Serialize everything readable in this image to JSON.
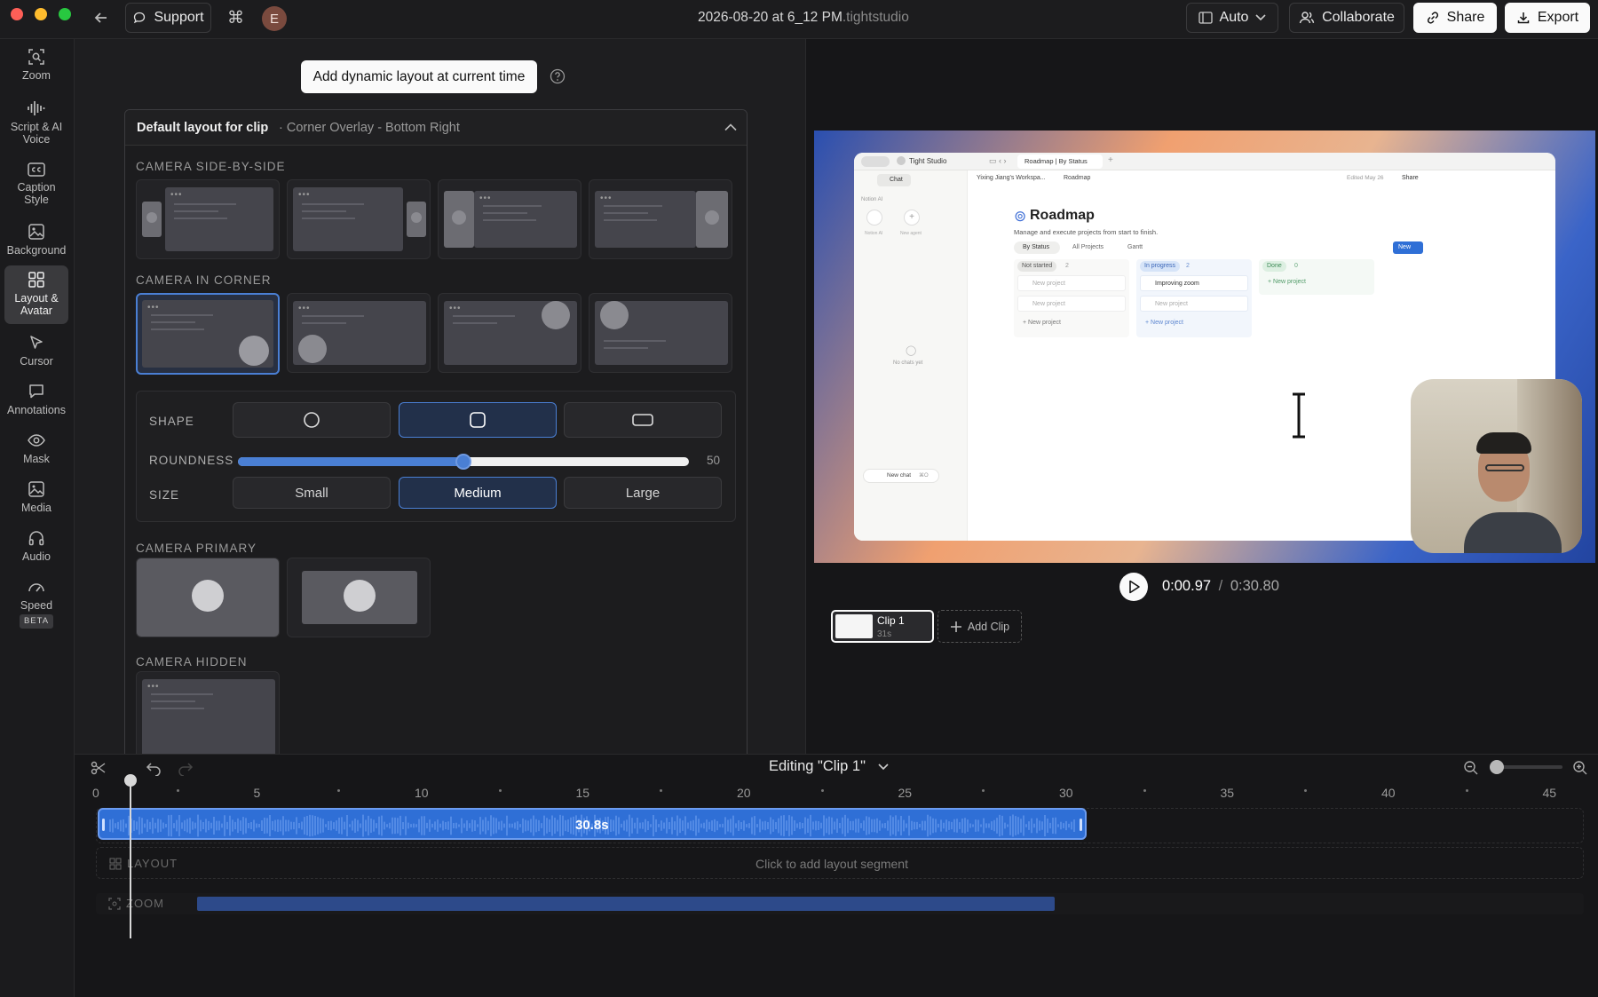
{
  "titlebar": {
    "support_label": "Support",
    "avatar_initial": "E",
    "file_title": "2026-08-20 at 6_12 PM",
    "file_ext": ".tightstudio",
    "auto_label": "Auto",
    "collaborate_label": "Collaborate",
    "share_label": "Share",
    "export_label": "Export"
  },
  "sidebar": {
    "items": [
      {
        "label": "Zoom",
        "icon": "zoom-icon"
      },
      {
        "label": "Script & AI Voice",
        "icon": "waveform-icon"
      },
      {
        "label": "Caption Style",
        "icon": "cc-icon"
      },
      {
        "label": "Background",
        "icon": "image-icon"
      },
      {
        "label": "Layout & Avatar",
        "icon": "grid-icon"
      },
      {
        "label": "Cursor",
        "icon": "cursor-icon"
      },
      {
        "label": "Annotations",
        "icon": "chat-icon"
      },
      {
        "label": "Mask",
        "icon": "eye-icon"
      },
      {
        "label": "Media",
        "icon": "media-icon"
      },
      {
        "label": "Audio",
        "icon": "headphones-icon"
      },
      {
        "label": "Speed",
        "icon": "gauge-icon",
        "badge": "BETA"
      }
    ]
  },
  "panel": {
    "dynamic_layout_label": "Add dynamic layout at current time",
    "card_title": "Default layout for clip",
    "card_subtitle": "· Corner Overlay - Bottom Right",
    "sections": {
      "side_by_side": "CAMERA SIDE-BY-SIDE",
      "in_corner": "CAMERA IN CORNER",
      "primary": "CAMERA PRIMARY",
      "hidden": "CAMERA HIDDEN"
    },
    "shape_label": "SHAPE",
    "roundness_label": "ROUNDNESS",
    "roundness_value": "50",
    "size_label": "SIZE",
    "size_options": [
      "Small",
      "Medium",
      "Large"
    ],
    "selected_size": "Medium",
    "selected_shape": "rounded-square"
  },
  "preview": {
    "notion": {
      "app_name": "Tight Studio",
      "tab_title": "Roadmap | By Status",
      "chat_label": "Chat",
      "breadcrumb_ws": "Yixing Jiang's Workspa...",
      "breadcrumb_page": "Roadmap",
      "edited": "Edited May 26",
      "share": "Share",
      "notion_ai": "Notion AI",
      "ai_label": "Notion AI",
      "new_agent": "New agent",
      "no_chats": "No chats yet",
      "new_chat": "New chat",
      "new_chat_kbd": "⌘O",
      "page_title": "Roadmap",
      "page_desc": "Manage and execute projects from start to finish.",
      "views": [
        "By Status",
        "All Projects",
        "Gantt"
      ],
      "new_btn": "New",
      "columns": [
        {
          "name": "Not started",
          "count": "2",
          "cards": [
            "New project",
            "New project"
          ],
          "add": "New project"
        },
        {
          "name": "In progress",
          "count": "2",
          "cards": [
            "Improving zoom",
            "New project"
          ],
          "add": "New project"
        },
        {
          "name": "Done",
          "count": "0",
          "cards": [],
          "add": "New project"
        }
      ]
    },
    "current_time": "0:00.97",
    "separator": "/",
    "total_time": "0:30.80"
  },
  "clips": {
    "clip_name": "Clip 1",
    "clip_duration": "31s",
    "add_clip_label": "Add Clip"
  },
  "timeline": {
    "editing_label": "Editing \"Clip 1\"",
    "ticks": [
      "0",
      "5",
      "10",
      "15",
      "20",
      "25",
      "30",
      "35",
      "40",
      "45"
    ],
    "clip_length": "30.8s",
    "layout_track": "LAYOUT",
    "layout_hint": "Click to add layout segment",
    "zoom_track": "ZOOM",
    "playhead_seconds": 0.97,
    "zoom_slider_level": 0
  },
  "colors": {
    "accent": "#4a7fd4",
    "clip_bar": "#2f6fd6",
    "zoom_bar": "#2d4a8a"
  }
}
